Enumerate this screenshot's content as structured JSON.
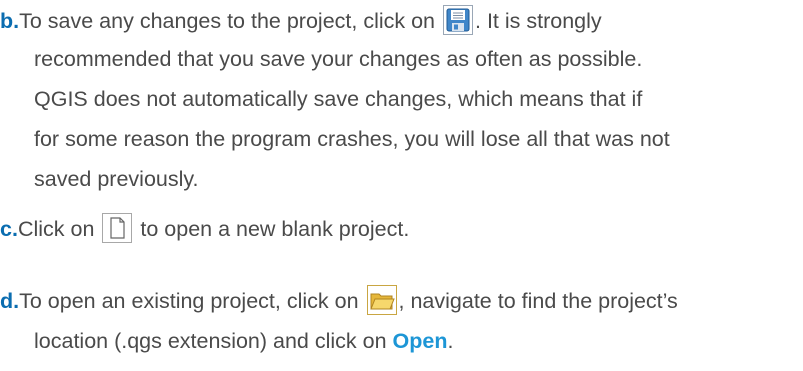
{
  "items": [
    {
      "marker": "b.",
      "lines": [
        "To save any changes to the project, click on",
        ". It is strongly",
        "recommended that you save your changes as often as possible.",
        "QGIS does not automatically save changes, which means that if",
        "for some reason the program crashes, you will lose all that was not",
        "saved previously."
      ],
      "icon": "save-disk-icon"
    },
    {
      "marker": "c.",
      "before_icon": "Click on",
      "after_icon": "to open a new blank project.",
      "icon": "new-blank-page-icon"
    },
    {
      "marker": "d.",
      "before_icon": "To open an existing project, click on",
      "after_icon": ", navigate to find the project’s",
      "line2_text": "location (.qgs extension) and click on ",
      "line2_link": "Open",
      "line2_end": ".",
      "icon": "open-folder-icon"
    }
  ],
  "colors": {
    "text": "#4a4a4a",
    "marker": "#0b6db0",
    "highlight": "#1d96d6"
  }
}
